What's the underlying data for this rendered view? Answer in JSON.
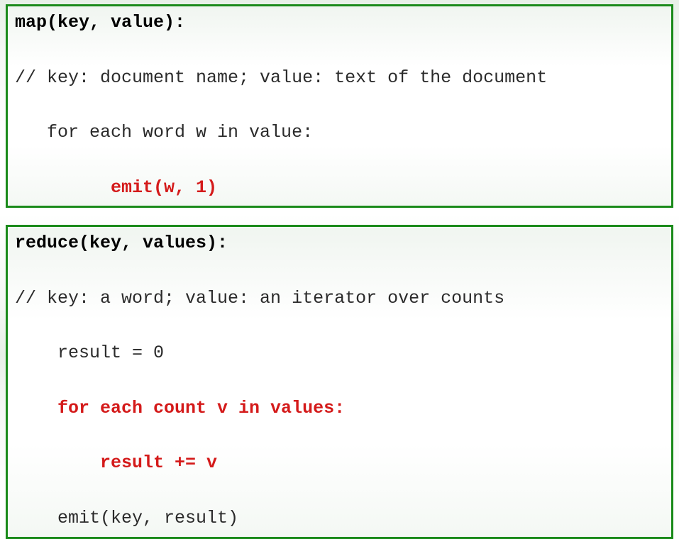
{
  "map_box": {
    "l1": "map(key, value):",
    "l2": "// key: document name; value: text of the document",
    "l3": "   for each word w in value:",
    "l4": "         emit(w, 1)"
  },
  "reduce_box": {
    "l1": "reduce(key, values):",
    "l2": "// key: a word; value: an iterator over counts",
    "l3": "    result = 0",
    "l4": "    for each count v in values:",
    "l5": "        result += v",
    "l6": "    emit(key, result)"
  }
}
